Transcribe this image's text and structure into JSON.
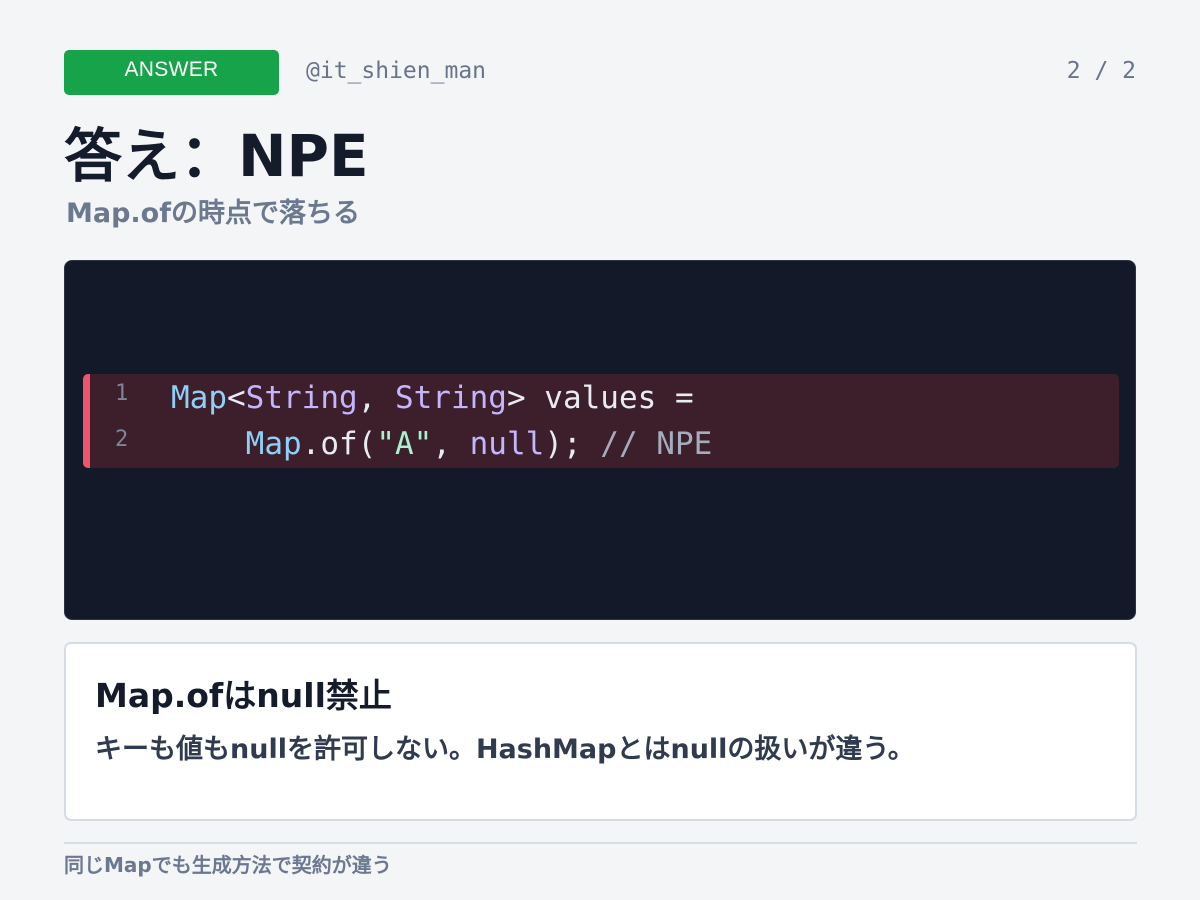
{
  "header": {
    "badge": "ANSWER",
    "handle": "@it_shien_man",
    "pager": "2 / 2"
  },
  "title": "答え：NPE",
  "subtitle": "Map.ofの時点で落ちる",
  "code": {
    "line_numbers": [
      "1",
      "2"
    ],
    "line1": {
      "t1": "Map",
      "t2": "<",
      "t3": "String",
      "t4": ", ",
      "t5": "String",
      "t6": "> values ="
    },
    "line2": {
      "t1": "    ",
      "t2": "Map",
      "t3": ".of(",
      "t4": "\"A\"",
      "t5": ", ",
      "t6": "null",
      "t7": "); ",
      "t8": "// NPE"
    },
    "highlight_color": "#f0546a"
  },
  "note": {
    "title": "Map.ofはnull禁止",
    "body": "キーも値もnullを許可しない。HashMapとはnullの扱いが違う。"
  },
  "footer": "同じMapでも生成方法で契約が違う",
  "colors": {
    "background": "#f3f5f7",
    "badge": "#16a34a",
    "code_background": "#131929",
    "highlight_row": "#3c1f2b"
  }
}
